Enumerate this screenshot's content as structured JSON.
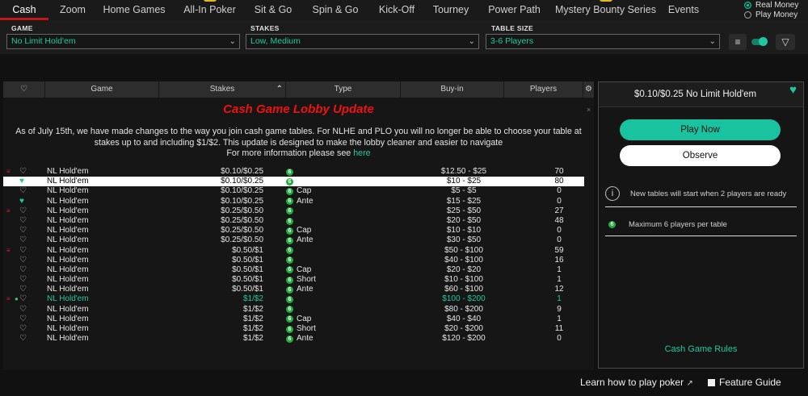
{
  "tabs": [
    {
      "label": "Cash",
      "active": true,
      "badge": false
    },
    {
      "label": "Zoom",
      "active": false,
      "badge": false
    },
    {
      "label": "Home Games",
      "active": false,
      "badge": false
    },
    {
      "label": "All-In Poker",
      "active": false,
      "badge": true
    },
    {
      "label": "Sit & Go",
      "active": false,
      "badge": false
    },
    {
      "label": "Spin & Go",
      "active": false,
      "badge": false
    },
    {
      "label": "Kick-Off",
      "active": false,
      "badge": false
    },
    {
      "label": "Tourney",
      "active": false,
      "badge": false
    },
    {
      "label": "Power Path",
      "active": false,
      "badge": false
    },
    {
      "label": "Mystery Bounty Series",
      "active": false,
      "badge": true
    },
    {
      "label": "Events",
      "active": false,
      "badge": false
    }
  ],
  "money_mode": {
    "real": "Real Money",
    "play": "Play Money",
    "selected": "real"
  },
  "filters": {
    "game": {
      "label": "GAME",
      "value": "No Limit Hold'em"
    },
    "stakes": {
      "label": "STAKES",
      "value": "Low, Medium"
    },
    "table_size": {
      "label": "TABLE SIZE",
      "value": "3-6 Players"
    }
  },
  "table_headers": {
    "game": "Game",
    "stakes": "Stakes",
    "type": "Type",
    "buyin": "Buy-in",
    "players": "Players"
  },
  "announcement": {
    "title": "Cash Game Lobby Update",
    "body": "As of July 15th, we have made changes to the way you join cash game tables. For NLHE and PLO you will no longer be able to choose your table at stakes up to and including $1/$2. This update is designed to make the lobby cleaner and easier to navigate",
    "more_prefix": "For more information please see",
    "link_text": "here"
  },
  "rows": [
    {
      "game": "NL Hold'em",
      "stakes": "$0.10/$0.25",
      "type": "",
      "buyin": "$12.50 - $25",
      "players": "70",
      "fire": true,
      "fav": false,
      "leaf": false,
      "state": ""
    },
    {
      "game": "NL Hold'em",
      "stakes": "$0.10/$0.25",
      "type": "",
      "buyin": "$10 - $25",
      "players": "80",
      "fire": false,
      "fav": true,
      "leaf": false,
      "state": "sel"
    },
    {
      "game": "NL Hold'em",
      "stakes": "$0.10/$0.25",
      "type": "Cap",
      "buyin": "$5 - $5",
      "players": "0",
      "fire": false,
      "fav": false,
      "leaf": false,
      "state": ""
    },
    {
      "game": "NL Hold'em",
      "stakes": "$0.10/$0.25",
      "type": "Ante",
      "buyin": "$15 - $25",
      "players": "0",
      "fire": false,
      "fav": true,
      "leaf": false,
      "state": ""
    },
    {
      "game": "NL Hold'em",
      "stakes": "$0.25/$0.50",
      "type": "",
      "buyin": "$25 - $50",
      "players": "27",
      "fire": true,
      "fav": false,
      "leaf": false,
      "state": ""
    },
    {
      "game": "NL Hold'em",
      "stakes": "$0.25/$0.50",
      "type": "",
      "buyin": "$20 - $50",
      "players": "48",
      "fire": false,
      "fav": false,
      "leaf": false,
      "state": ""
    },
    {
      "game": "NL Hold'em",
      "stakes": "$0.25/$0.50",
      "type": "Cap",
      "buyin": "$10 - $10",
      "players": "0",
      "fire": false,
      "fav": false,
      "leaf": false,
      "state": ""
    },
    {
      "game": "NL Hold'em",
      "stakes": "$0.25/$0.50",
      "type": "Ante",
      "buyin": "$30 - $50",
      "players": "0",
      "fire": false,
      "fav": false,
      "leaf": false,
      "state": ""
    },
    {
      "game": "NL Hold'em",
      "stakes": "$0.50/$1",
      "type": "",
      "buyin": "$50 - $100",
      "players": "59",
      "fire": true,
      "fav": false,
      "leaf": false,
      "state": ""
    },
    {
      "game": "NL Hold'em",
      "stakes": "$0.50/$1",
      "type": "",
      "buyin": "$40 - $100",
      "players": "16",
      "fire": false,
      "fav": false,
      "leaf": false,
      "state": ""
    },
    {
      "game": "NL Hold'em",
      "stakes": "$0.50/$1",
      "type": "Cap",
      "buyin": "$20 - $20",
      "players": "1",
      "fire": false,
      "fav": false,
      "leaf": false,
      "state": ""
    },
    {
      "game": "NL Hold'em",
      "stakes": "$0.50/$1",
      "type": "Short",
      "buyin": "$10 - $100",
      "players": "1",
      "fire": false,
      "fav": false,
      "leaf": false,
      "state": ""
    },
    {
      "game": "NL Hold'em",
      "stakes": "$0.50/$1",
      "type": "Ante",
      "buyin": "$60 - $100",
      "players": "12",
      "fire": false,
      "fav": false,
      "leaf": false,
      "state": ""
    },
    {
      "game": "NL Hold'em",
      "stakes": "$1/$2",
      "type": "",
      "buyin": "$100 - $200",
      "players": "1",
      "fire": true,
      "fav": false,
      "leaf": true,
      "state": "hl"
    },
    {
      "game": "NL Hold'em",
      "stakes": "$1/$2",
      "type": "",
      "buyin": "$80 - $200",
      "players": "9",
      "fire": false,
      "fav": false,
      "leaf": false,
      "state": ""
    },
    {
      "game": "NL Hold'em",
      "stakes": "$1/$2",
      "type": "Cap",
      "buyin": "$40 - $40",
      "players": "1",
      "fire": false,
      "fav": false,
      "leaf": false,
      "state": ""
    },
    {
      "game": "NL Hold'em",
      "stakes": "$1/$2",
      "type": "Short",
      "buyin": "$20 - $200",
      "players": "11",
      "fire": false,
      "fav": false,
      "leaf": false,
      "state": ""
    },
    {
      "game": "NL Hold'em",
      "stakes": "$1/$2",
      "type": "Ante",
      "buyin": "$120 - $200",
      "players": "0",
      "fire": false,
      "fav": false,
      "leaf": false,
      "state": ""
    }
  ],
  "six_max_badge": "6",
  "panel": {
    "title": "$0.10/$0.25  No Limit Hold'em",
    "play_now": "Play Now",
    "observe": "Observe",
    "info_new_tables": "New tables will start when 2 players are ready",
    "info_max_players": "Maximum 6 players per table",
    "rules_link": "Cash Game Rules"
  },
  "bottom": {
    "learn": "Learn how to play poker",
    "guide": "Feature Guide"
  },
  "colors": {
    "accent": "#19c39f",
    "active_tab": "#c0161c",
    "announce_title": "#ef1111",
    "six_badge": "#1fae3c"
  }
}
